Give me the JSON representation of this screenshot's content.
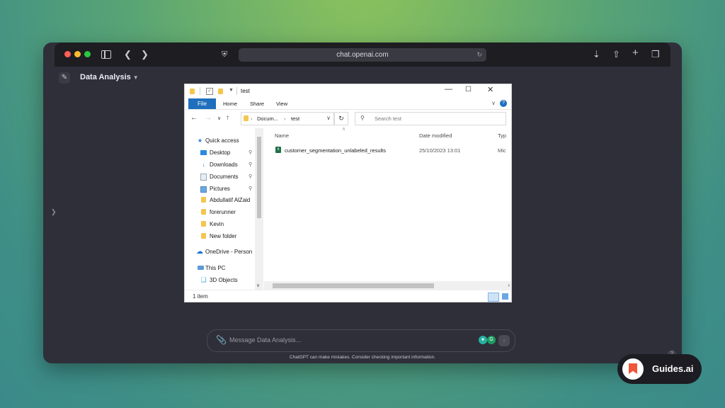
{
  "browser": {
    "address": "chat.openai.com"
  },
  "app": {
    "title": "Data Analysis",
    "composer_placeholder": "Message Data Analysis...",
    "disclaimer": "ChatGPT can make mistakes. Consider checking important information."
  },
  "explorer": {
    "title": "test",
    "ribbon_tabs": [
      "File",
      "Home",
      "Share",
      "View"
    ],
    "path": [
      "Docum...",
      "test"
    ],
    "search_placeholder": "Search test",
    "nav_items": [
      {
        "label": "Quick access",
        "icon": "star-icon"
      },
      {
        "label": "Desktop",
        "icon": "desktop-icon",
        "pinned": true
      },
      {
        "label": "Downloads",
        "icon": "download-icon",
        "pinned": true
      },
      {
        "label": "Documents",
        "icon": "documents-icon",
        "pinned": true
      },
      {
        "label": "Pictures",
        "icon": "pictures-icon",
        "pinned": true
      },
      {
        "label": "Abdullatif AlZaid",
        "icon": "folder-icon"
      },
      {
        "label": "forerunner",
        "icon": "folder-icon"
      },
      {
        "label": "Kevin",
        "icon": "folder-icon"
      },
      {
        "label": "New folder",
        "icon": "folder-icon"
      },
      {
        "label": "OneDrive - Person",
        "icon": "cloud-icon"
      },
      {
        "label": "This PC",
        "icon": "pc-icon"
      },
      {
        "label": "3D Objects",
        "icon": "cube-icon"
      }
    ],
    "columns": [
      "Name",
      "Date modified",
      "Typ"
    ],
    "files": [
      {
        "name": "customer_segmentation_unlabeled_results",
        "modified": "25/10/2023 13:01",
        "type": "Mic"
      }
    ],
    "status": "1 item"
  },
  "badge": {
    "text": "Guides.ai"
  }
}
